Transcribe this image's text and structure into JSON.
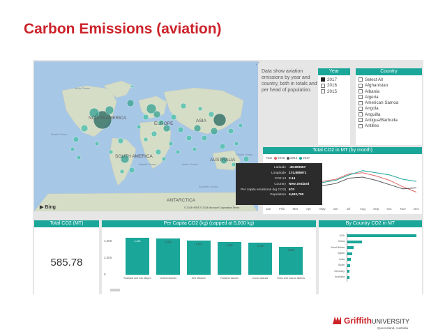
{
  "slide": {
    "title": "Carbon Emissions (aviation)"
  },
  "map": {
    "labels": {
      "na": "NORTH AMERICA",
      "eu": "EUROPE",
      "asia": "ASIA",
      "sa": "SOUTH AMERICA",
      "aus": "AUSTRALIA",
      "ant": "ANTARCTICA"
    },
    "oceans": {
      "arctic": "Arctic Ocean",
      "pacific": "Pacific Ocean",
      "atlantic": "Atlantic Ocean",
      "indian": "Indian Ocean",
      "pacific2": "Pacific Ocean",
      "southern": "Southern Ocean"
    },
    "bing": "Bing",
    "copyright": "© 2018 HERE  © 2018 Microsoft Corporation  Terms"
  },
  "tooltip": [
    {
      "k": "Latitude",
      "v": "-40.900557"
    },
    {
      "k": "Longitude",
      "v": "174.885971"
    },
    {
      "k": "CO2 int",
      "v": "3.14"
    },
    {
      "k": "Country",
      "v": "New Zealand"
    },
    {
      "k": "Per capita emissions (kg CO2)",
      "v": "670"
    },
    {
      "k": "Population",
      "v": "4,692,700"
    }
  ],
  "description": "Data show aviation emissions by year and country, both in totals and per head of population.",
  "year_slicer": {
    "title": "Year",
    "items": [
      {
        "label": "2017",
        "checked": true
      },
      {
        "label": "2016",
        "checked": false
      },
      {
        "label": "2015",
        "checked": false
      }
    ]
  },
  "country_slicer": {
    "title": "Country",
    "items": [
      "Select All",
      "Afghanistan",
      "Albania",
      "Algeria",
      "American Samoa",
      "Angola",
      "Anguilla",
      "Antigua/Barbuda",
      "Antilles"
    ]
  },
  "monthly": {
    "title": "Total CO2 in MT (by month)",
    "legend": {
      "label": "Year",
      "series": [
        "2015",
        "2016",
        "2017"
      ]
    },
    "colors": {
      "2015": "#e06666",
      "2016": "#555555",
      "2017": "#1aa699"
    },
    "months": [
      "Jan",
      "Feb",
      "Mar",
      "Apr",
      "May",
      "Jun",
      "Jul",
      "Aug",
      "Sep",
      "Oct",
      "Nov",
      "Dec"
    ]
  },
  "kpi": {
    "title": "Total CO2 (MT)",
    "value": "585.78"
  },
  "per_capita": {
    "title": "Per Capita CO2 (kg) (capped at 5,000 kg)"
  },
  "by_country": {
    "title": "By Country CO2 in MT"
  },
  "chart_data": [
    {
      "type": "bar",
      "title": "Per Capita CO2 (kg) (capped at 5,000 kg)",
      "categories": [
        "Svalbard and Jan Mayen",
        "Norfolk Islands",
        "Sint Maarten",
        "Falkland Islands",
        "Cocos Islands",
        "Turks and Caicos Islands"
      ],
      "values": [
        4443,
        4330,
        4123,
        3926,
        3796,
        3365
      ],
      "value_labels": [
        "4,443",
        "4,330",
        "4,123",
        "3,926",
        "3,796",
        "3,365"
      ],
      "yticks": [
        "4,000",
        "2,000",
        "0"
      ],
      "ylim": [
        0,
        5000
      ]
    },
    {
      "type": "bar",
      "orientation": "horizontal",
      "title": "By Country CO2 in MT",
      "categories": [
        "USA",
        "China",
        "Great Britain",
        "Japan",
        "India",
        "Spain",
        "Germany",
        "Australia"
      ],
      "values": [
        180,
        40,
        18,
        14,
        11,
        9,
        8,
        7
      ]
    },
    {
      "type": "line",
      "title": "Total CO2 in MT (by month)",
      "categories": [
        "Jan",
        "Feb",
        "Mar",
        "Apr",
        "May",
        "Jun",
        "Jul",
        "Aug",
        "Sep",
        "Oct",
        "Nov",
        "Dec"
      ],
      "series": [
        {
          "name": "2015",
          "values": [
            50,
            47,
            49,
            48,
            50,
            52,
            57,
            58,
            55,
            51,
            45,
            40
          ]
        },
        {
          "name": "2016",
          "values": [
            45,
            42,
            44,
            45,
            46,
            48,
            53,
            54,
            51,
            47,
            43,
            44
          ]
        },
        {
          "name": "2017",
          "values": [
            48,
            46,
            47,
            47,
            49,
            51,
            56,
            60,
            58,
            56,
            52,
            50
          ]
        }
      ]
    }
  ],
  "logo": {
    "brand": "Griffith",
    "suffix": "UNIVERSITY",
    "tagline": "Queensland, Australia"
  }
}
